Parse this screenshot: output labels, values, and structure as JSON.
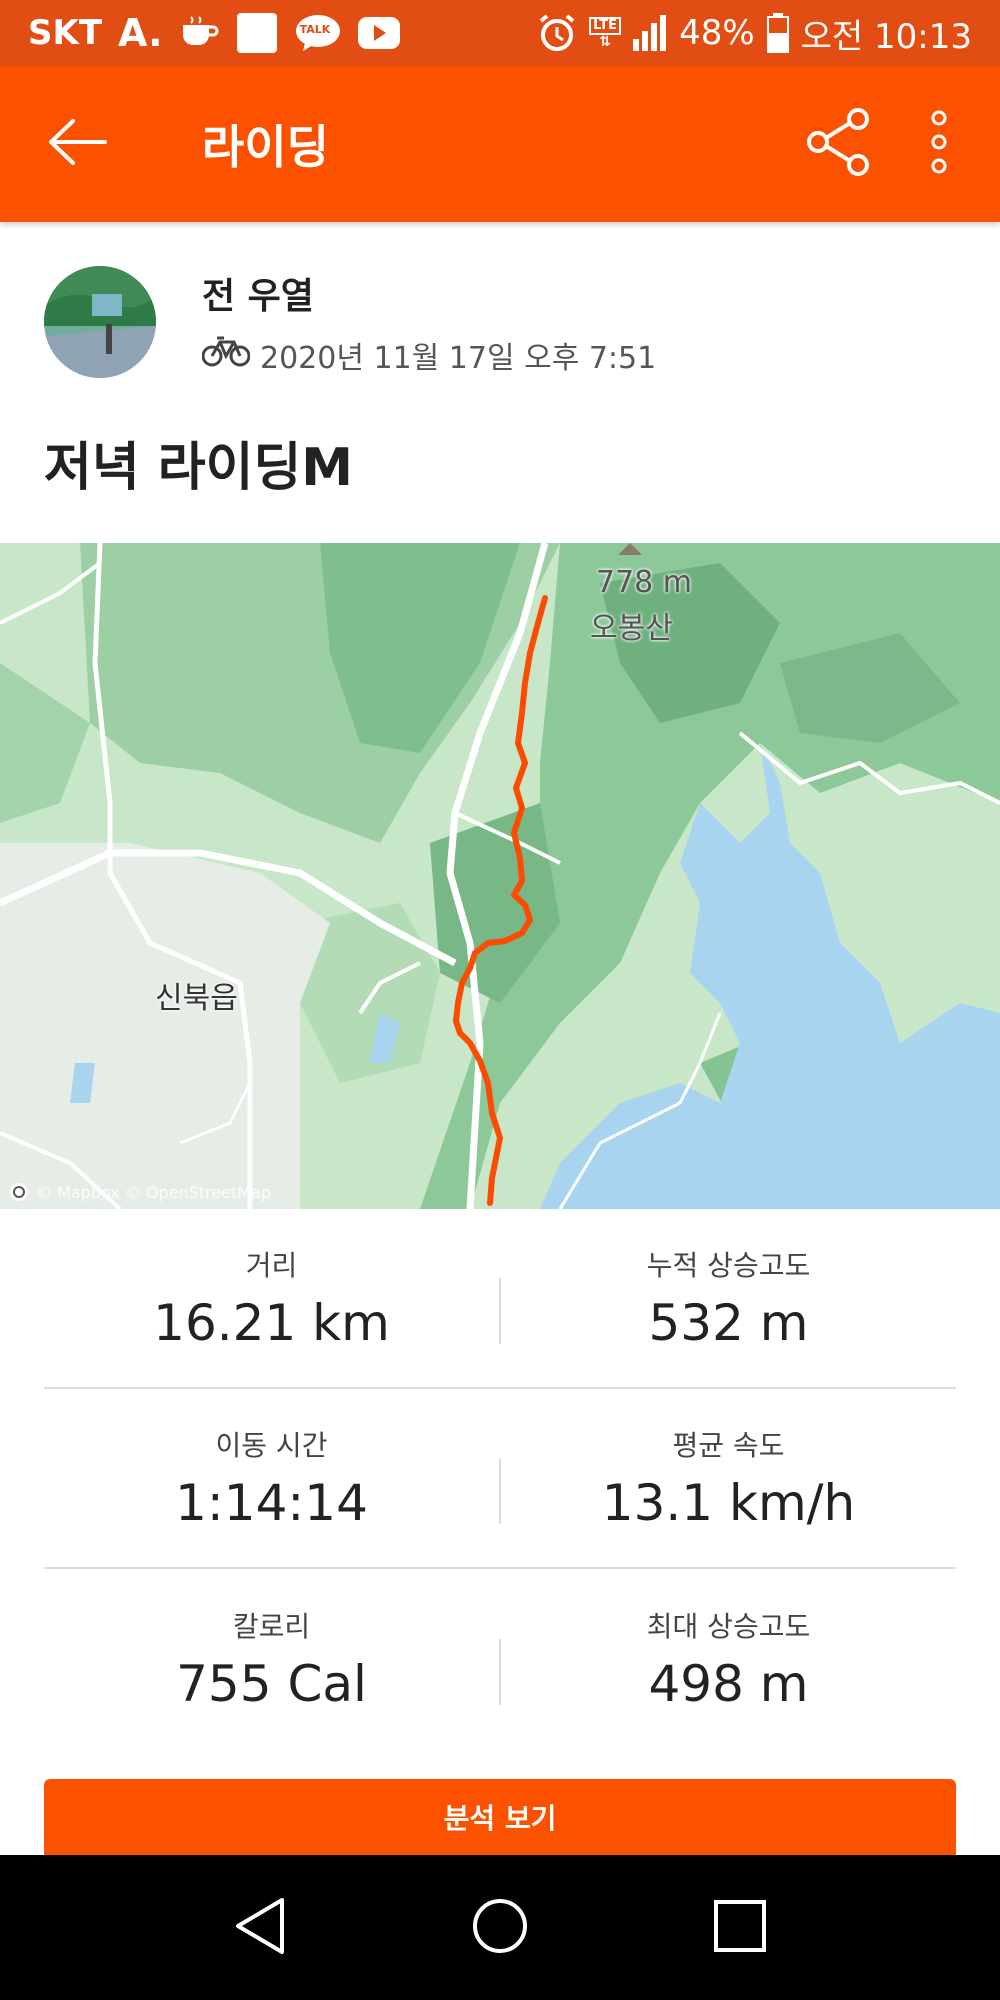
{
  "status_bar": {
    "carrier": "SKT",
    "app_letter": "A.",
    "talk_badge": "TALK",
    "network": "LTE",
    "battery": "48%",
    "time": "오전 10:13",
    "icons": [
      "coffee-icon",
      "white-square-icon",
      "talk-icon",
      "youtube-icon",
      "alarm-icon",
      "lte-icon",
      "signal-icon",
      "battery-icon"
    ]
  },
  "app_bar": {
    "title": "라이딩",
    "icons": [
      "back-arrow-icon",
      "share-icon",
      "more-vertical-icon"
    ]
  },
  "athlete": {
    "name": "전 우열",
    "datetime": "2020년 11월 17일 오후 7:51",
    "sport_icon": "bike-icon"
  },
  "activity": {
    "title": "저녁 라이딩M"
  },
  "map": {
    "peak_elevation": "778 m",
    "peak_name": "오봉산",
    "town": "신북읍",
    "attribution": "© Mapbox © OpenStreetMap",
    "route_color": "#fc4c02",
    "water_color": "#a9d4f0",
    "forest_color": "#8cc898"
  },
  "stats": {
    "rows": [
      [
        {
          "label": "거리",
          "value": "16.21 km"
        },
        {
          "label": "누적 상승고도",
          "value": "532 m"
        }
      ],
      [
        {
          "label": "이동 시간",
          "value": "1:14:14"
        },
        {
          "label": "평균 속도",
          "value": "13.1 km/h"
        }
      ],
      [
        {
          "label": "칼로리",
          "value": "755 Cal"
        },
        {
          "label": "최대 상승고도",
          "value": "498 m"
        }
      ]
    ]
  },
  "analysis_button": {
    "label": "분석 보기"
  },
  "nav": {
    "icons": [
      "back-triangle-icon",
      "home-circle-icon",
      "recents-square-icon"
    ]
  },
  "colors": {
    "accent": "#fc5200",
    "status_bar": "#e24d13"
  }
}
